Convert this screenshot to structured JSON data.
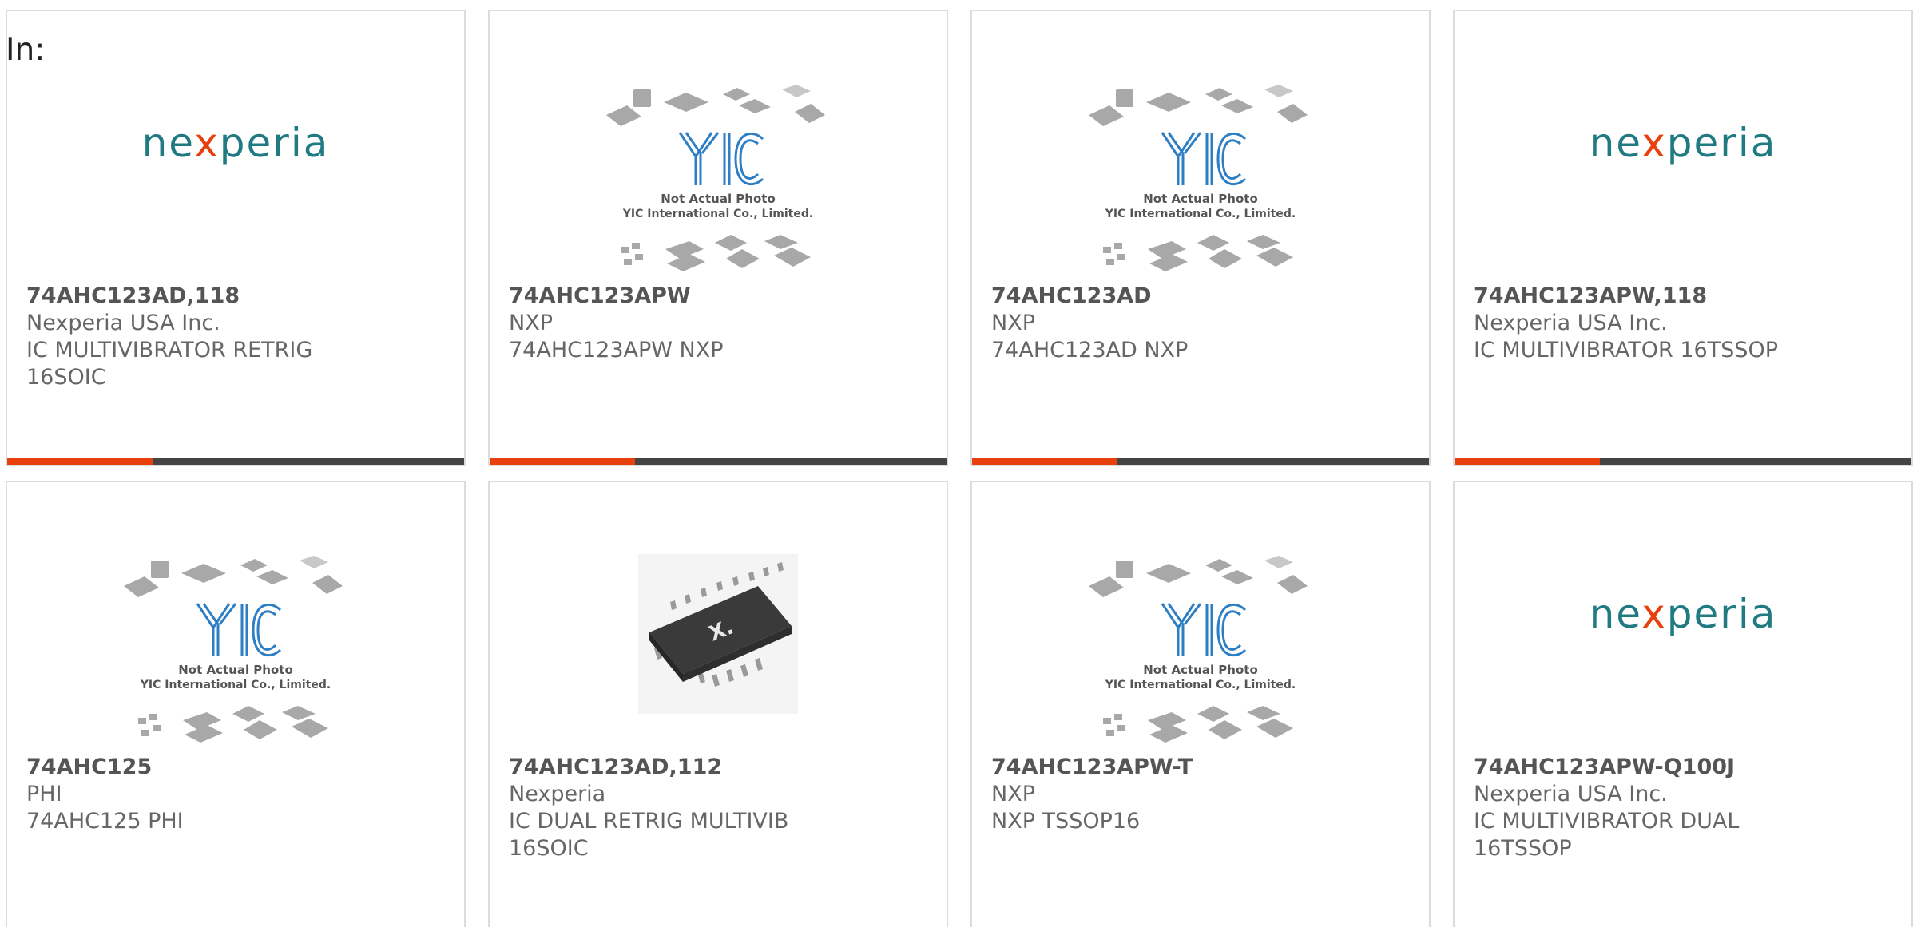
{
  "header": {
    "in_label": "In:"
  },
  "colors": {
    "accent": "#e8400c",
    "bar": "#444444",
    "nexperia_teal": "#1f7a82"
  },
  "cards": [
    {
      "part_no": "74AHC123AD,118",
      "manufacturer": "Nexperia USA Inc.",
      "description": "IC MULTIVIBRATOR RETRIG 16SOIC",
      "image": "nexperia-logo"
    },
    {
      "part_no": "74AHC123APW",
      "manufacturer": "NXP",
      "description": "74AHC123APW NXP",
      "image": "yic-placeholder"
    },
    {
      "part_no": "74AHC123AD",
      "manufacturer": "NXP",
      "description": "74AHC123AD NXP",
      "image": "yic-placeholder"
    },
    {
      "part_no": "74AHC123APW,118",
      "manufacturer": "Nexperia USA Inc.",
      "description": "IC MULTIVIBRATOR 16TSSOP",
      "image": "nexperia-logo"
    },
    {
      "part_no": "74AHC125",
      "manufacturer": "PHI",
      "description": "74AHC125 PHI",
      "image": "yic-placeholder"
    },
    {
      "part_no": "74AHC123AD,112",
      "manufacturer": "Nexperia",
      "description": "IC DUAL RETRIG MULTIVIB 16SOIC",
      "image": "soic-chip-photo"
    },
    {
      "part_no": "74AHC123APW-T",
      "manufacturer": "NXP",
      "description": "NXP TSSOP16",
      "image": "yic-placeholder"
    },
    {
      "part_no": "74AHC123APW-Q100J",
      "manufacturer": "Nexperia USA Inc.",
      "description": "IC MULTIVIBRATOR DUAL 16TSSOP",
      "image": "nexperia-logo"
    }
  ],
  "placeholder": {
    "line1": "Not Actual Photo",
    "line2": "YIC International Co., Limited."
  },
  "logos": {
    "nexperia_pre": "ne",
    "nexperia_x": "x",
    "nexperia_post": "peria",
    "yic": "YIC",
    "chip_mark": "X."
  }
}
